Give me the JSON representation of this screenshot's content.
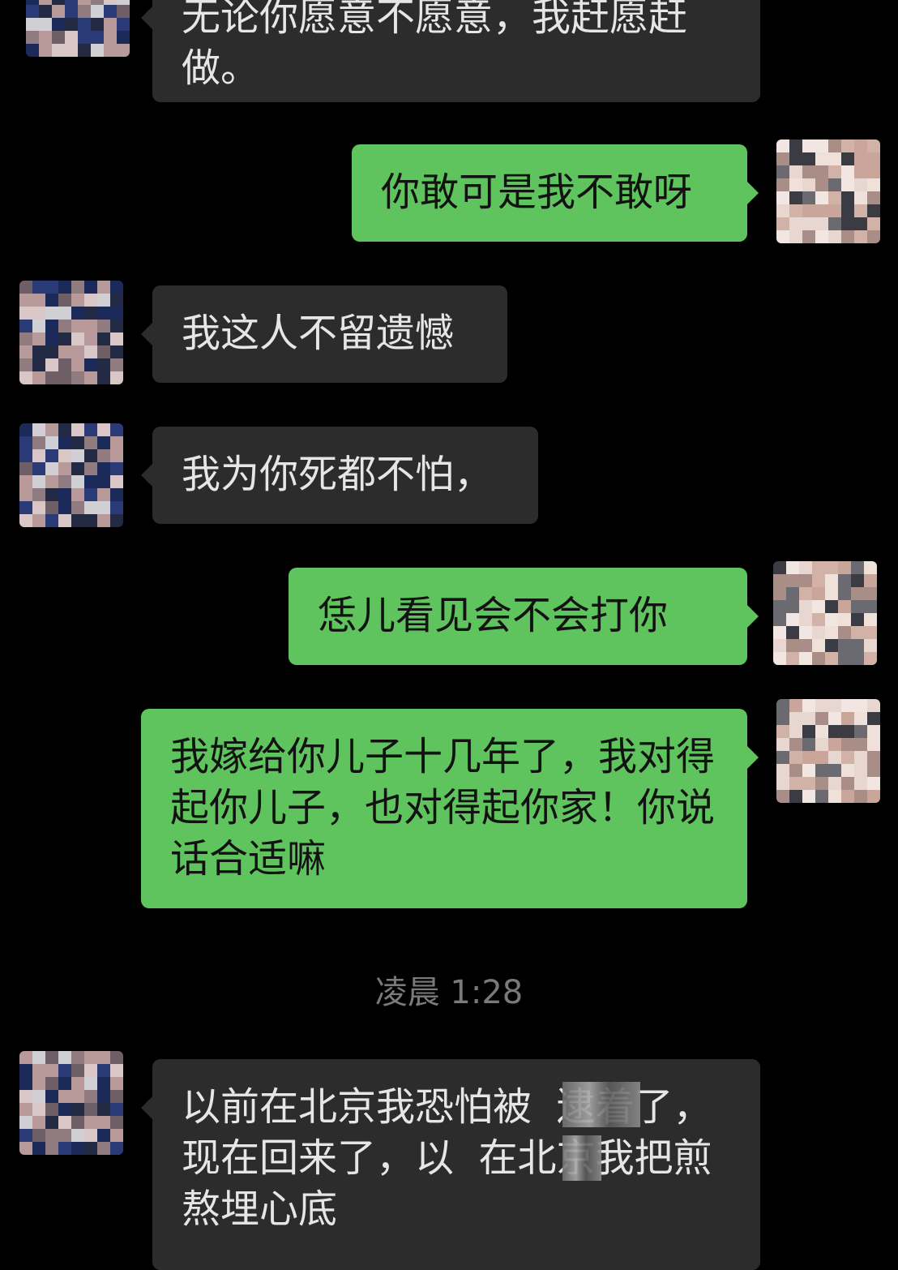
{
  "messages": [
    {
      "side": "left",
      "text": "无论你愿意不愿意，我赶愿赶做。"
    },
    {
      "side": "right",
      "text": "你敢可是我不敢呀"
    },
    {
      "side": "left",
      "text": "我这人不留遗憾"
    },
    {
      "side": "left",
      "text": "我为你死都不怕，"
    },
    {
      "side": "right",
      "text": "恁儿看见会不会打你"
    },
    {
      "side": "right",
      "text": "我嫁给你儿子十几年了，我对得起你儿子，也对得起你家！你说话合适嘛"
    },
    {
      "side": "left",
      "text": "以前在北京我恐怕被  逮着了，现在回来了，以  在北京我把煎熬埋心底"
    }
  ],
  "timestamp": "凌晨 1:28",
  "colors": {
    "background": "#000000",
    "incoming_bubble": "#2c2c2c",
    "outgoing_bubble": "#5fc45d",
    "incoming_text": "#e6e6e6",
    "outgoing_text": "#121212",
    "timestamp_text": "#7a7a7a"
  }
}
